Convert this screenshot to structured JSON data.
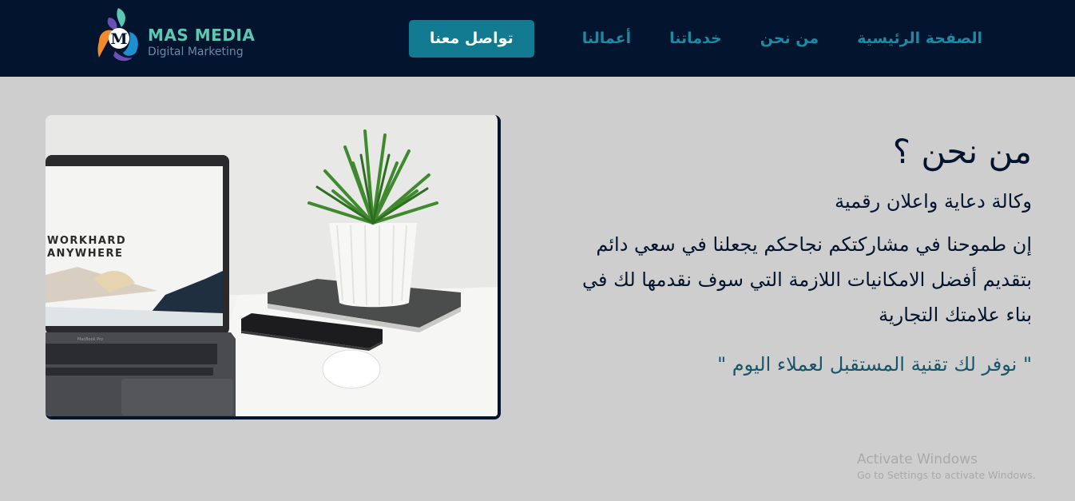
{
  "brand": {
    "name": "MAS MEDIA",
    "tagline": "Digital Marketing",
    "logo_letter": "M",
    "colors": {
      "teal": "#5cc7b3",
      "orange": "#f08a2a",
      "purple": "#6b4fb5",
      "blue": "#1f8fd0"
    }
  },
  "nav": {
    "items": [
      {
        "label": "الصفحة الرئيسية"
      },
      {
        "label": "من نحن"
      },
      {
        "label": "خدماتنا"
      },
      {
        "label": "أعمالنا"
      }
    ],
    "cta_label": "تواصل معنا"
  },
  "hero_image": {
    "screen_line1": "WORKHARD",
    "screen_line2": "ANYWHERE",
    "laptop_brand": "MacBook Pro"
  },
  "about": {
    "title": "من نحن ؟",
    "subtitle": "وكالة دعاية واعلان رقمية",
    "body": "إن طموحنا في مشاركتكم نجاحكم يجعلنا في سعي دائم بتقديم أفضل الامكانيات اللازمة التي سوف نقدمها لك في بناء علامتك التجارية",
    "quote": "\" نوفر لك تقنية المستقبل لعملاء اليوم \""
  },
  "watermark": {
    "title": "Activate Windows",
    "subtitle": "Go to Settings to activate Windows."
  },
  "colors": {
    "navbar_bg": "#03142e",
    "nav_link": "#1a8aa5",
    "cta_bg": "#137b91",
    "page_bg": "#cecece",
    "quote": "#17566a"
  }
}
